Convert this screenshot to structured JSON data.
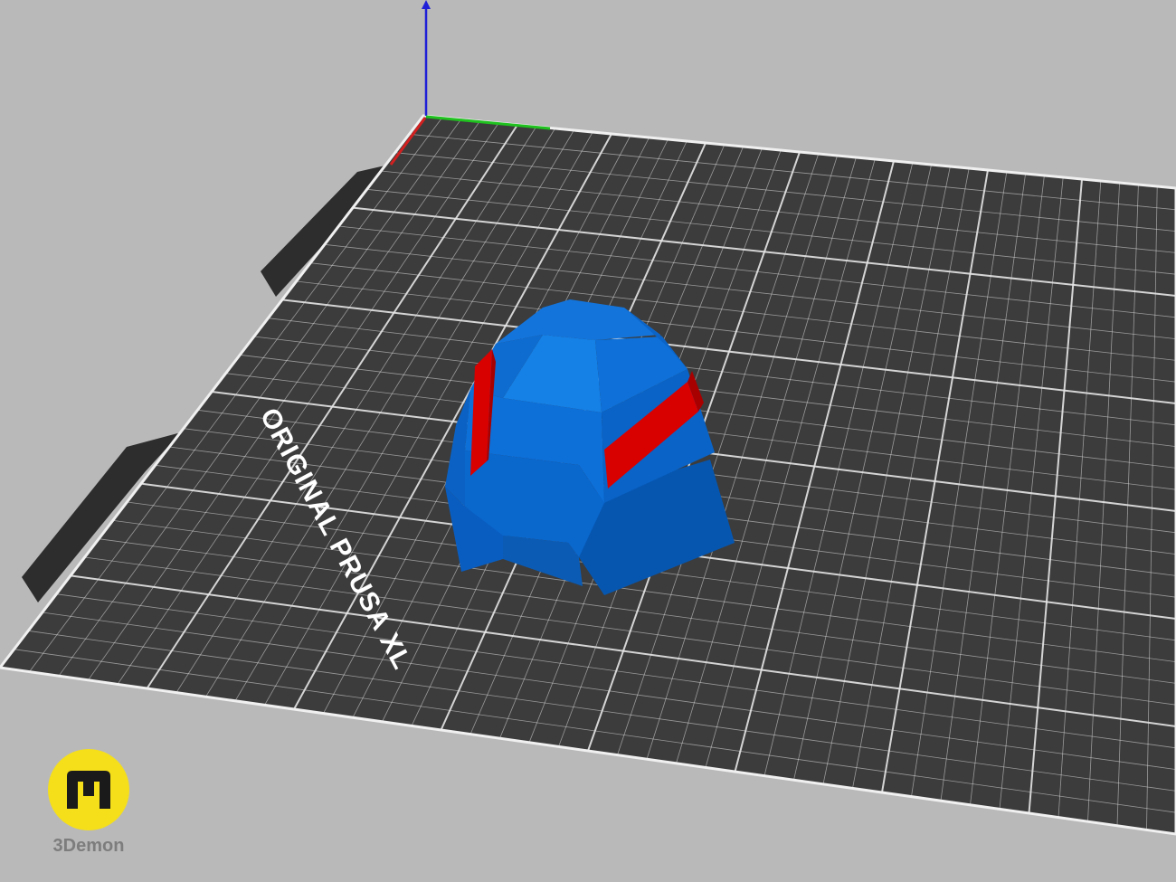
{
  "scene": {
    "background_color": "#b9b9b9",
    "bed": {
      "label": "ORIGINAL PRUSA XL",
      "surface_color": "#3c3c3c",
      "grid_color": "#e6e6e6",
      "tab_color": "#2d2d2d"
    },
    "axes": {
      "x_color": "#d22020",
      "y_color": "#1fc21f",
      "z_color": "#1f1fd8"
    },
    "model": {
      "name": "helmet-part",
      "primary_color": "#0a67cc",
      "accent_color": "#d90000"
    }
  },
  "branding": {
    "logo_glyph": "m",
    "logo_text": "3Demon",
    "logo_color": "#f5df1a"
  }
}
